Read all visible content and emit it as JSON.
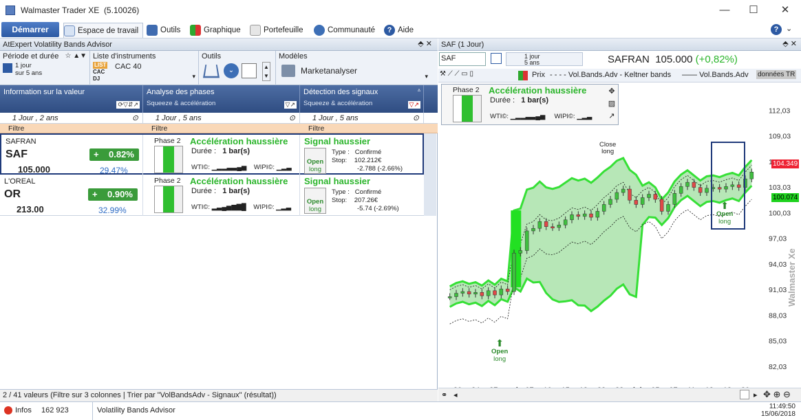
{
  "window": {
    "title": "Walmaster Trader XE",
    "version": "(5.10026)",
    "minimize": "—",
    "maximize": "☐",
    "close": "✕"
  },
  "menu": {
    "start": "Démarrer",
    "items": [
      "Espace de travail",
      "Outils",
      "Graphique",
      "Portefeuille",
      "Communauté",
      "Aide"
    ]
  },
  "left": {
    "pane_title": "AtExpert Volatility Bands Advisor",
    "period_label": "Période et durée",
    "period_value1": "1 jour",
    "period_value2": "sur 5 ans",
    "list_label": "Liste d'instruments",
    "list_value": "CAC 40",
    "list_tags": [
      "LIST",
      "CAC",
      "DJ"
    ],
    "tools_label": "Outils",
    "models_label": "Modèles",
    "models_value": "Marketanalyser",
    "columns": [
      {
        "title": "Information sur la valeur",
        "sub": ""
      },
      {
        "title": "Analyse des phases",
        "sub": "Squeeze & accélération"
      },
      {
        "title": "Détection des signaux",
        "sub": "Squeeze & accélération"
      }
    ],
    "selectors": [
      "1 Jour , 2 ans",
      "1 Jour , 5 ans",
      "1 Jour , 5 ans"
    ],
    "filter_label": "Filtre",
    "rows": [
      {
        "name": "SAFRAN",
        "ticker": "SAF",
        "price": "105.000",
        "change": "0.82%",
        "volume_pct": "29.47%",
        "phase": "Phase 2",
        "phase_title": "Accélération haussière",
        "duration_label": "Durée :",
        "duration": "1 bar(s)",
        "wti": "WTI©:",
        "wipi": "WIPI©:",
        "signal_title": "Signal haussier",
        "signal_open": "Open",
        "signal_long": "long",
        "type_label": "Type :",
        "type": "Confirmé",
        "stop_label": "Stop:",
        "stop": "102.212€",
        "stop_diff": "-2.788 (-2.66%)"
      },
      {
        "name": "L'OREAL",
        "ticker": "OR",
        "price": "213.00",
        "change": "0.90%",
        "volume_pct": "32.99%",
        "phase": "Phase 2",
        "phase_title": "Accélération haussière",
        "duration_label": "Durée :",
        "duration": "1 bar(s)",
        "wti": "WTI©:",
        "wipi": "WIPI©:",
        "signal_title": "Signal haussier",
        "signal_open": "Open",
        "signal_long": "long",
        "type_label": "Type :",
        "type": "Confirmé",
        "stop_label": "Stop:",
        "stop": "207.26€",
        "stop_diff": "-5.74 (-2.69%)"
      }
    ],
    "status": "2 / 41 valeurs (Filtre sur 3 colonnes | Trier par \"VolBandsAdv - Signaux\" (résultat))"
  },
  "info": {
    "label": "Infos",
    "count": "162 923",
    "tab": "Volatility Bands Advisor",
    "time": "11:49:50",
    "date": "15/06/2018"
  },
  "right": {
    "pane_title": "SAF (1 Jour)",
    "symbol_input": "SAF",
    "period1": "1 jour",
    "period2": "5 ans",
    "instrument": "SAFRAN",
    "price": "105.000",
    "change": "(+0,82%)",
    "legend": [
      "Prix",
      "Vol.Bands.Adv - Keltner bands",
      "Vol.Bands.Adv",
      "données TR"
    ],
    "overlay": {
      "phase": "Phase 2",
      "title": "Accélération haussière",
      "duration_label": "Durée :",
      "duration": "1 bar(s)",
      "wti": "WTI©:",
      "wipi": "WIPI©:"
    },
    "close_label": "Close",
    "close_sub": "long",
    "open_label": "Open",
    "open_sub": "long",
    "watermark": "Walmaster Xe",
    "price_tag_red": "104.349",
    "price_tag_green": "100.074",
    "yticks": [
      "112,03",
      "109,03",
      "106,03",
      "103,03",
      "100,03",
      "97,03",
      "94,03",
      "91,03",
      "88,03",
      "85,03",
      "82,03"
    ],
    "xticks": [
      "20",
      "24",
      "27",
      "mai",
      "07",
      "10",
      "15",
      "18",
      "23",
      "28",
      "jui",
      "05",
      "07",
      "11",
      "13",
      "18",
      "20"
    ]
  },
  "chart_data": {
    "type": "candlestick",
    "ylim": [
      80.5,
      114
    ],
    "series": [
      {
        "name": "Prix",
        "values": [
          90.2,
          90.6,
          90.8,
          90.5,
          90.7,
          90.3,
          90.9,
          90.4,
          91.1,
          90.8,
          95.3,
          95.6,
          97.9,
          98.2,
          99.0,
          98.4,
          98.3,
          98.6,
          99.2,
          99.8,
          99.6,
          99.9,
          99.5,
          100.2,
          101.0,
          101.6,
          102.4,
          102.8,
          101.5,
          101.0,
          101.8,
          102.2,
          101.6,
          100.2,
          101.0,
          102.3,
          103.1,
          103.6,
          103.0,
          102.4,
          102.9,
          103.0,
          102.8,
          103.1,
          103.3,
          103.0,
          104.0,
          104.8
        ]
      }
    ]
  }
}
